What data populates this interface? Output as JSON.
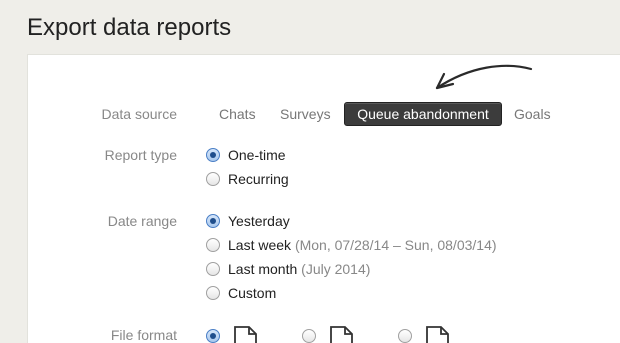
{
  "page": {
    "title": "Export data reports"
  },
  "data_source": {
    "label": "Data source",
    "tabs": [
      "Chats",
      "Surveys",
      "Queue abandonment",
      "Goals"
    ],
    "selected": "Queue abandonment"
  },
  "report_type": {
    "label": "Report type",
    "options": [
      "One-time",
      "Recurring"
    ],
    "selected": "One-time"
  },
  "date_range": {
    "label": "Date range",
    "options": [
      {
        "label": "Yesterday",
        "detail": ""
      },
      {
        "label": "Last week",
        "detail": "(Mon, 07/28/14 – Sun, 08/03/14)"
      },
      {
        "label": "Last month",
        "detail": "(July 2014)"
      },
      {
        "label": "Custom",
        "detail": ""
      }
    ],
    "selected": "Yesterday"
  },
  "file_format": {
    "label": "File format",
    "icons": [
      "file-icon",
      "file-icon",
      "file-icon"
    ]
  },
  "colors": {
    "background": "#efeee9",
    "active_tab": "#3c3c3c",
    "radio_checked": "#4a7fc6",
    "label_text": "#888888"
  }
}
